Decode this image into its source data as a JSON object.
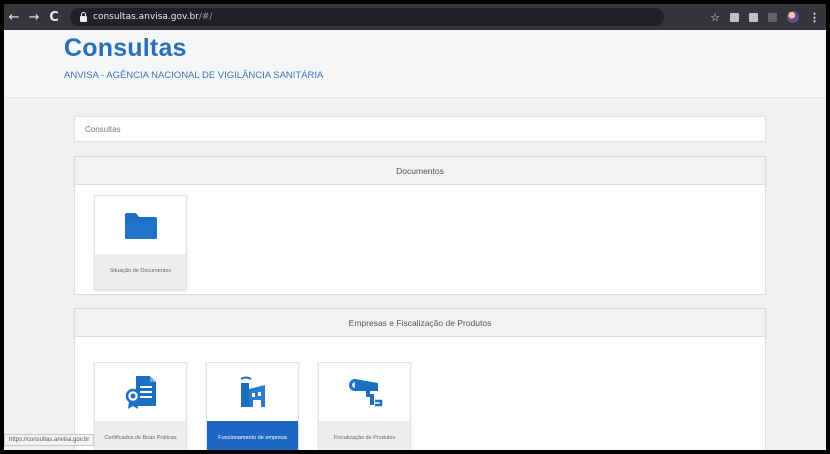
{
  "browser": {
    "url_host": "consultas.anvisa.gov.br",
    "url_path": "/#/",
    "back_icon": "←",
    "forward_icon": "→",
    "reload_icon": "C",
    "star_icon": "☆",
    "menu_icon": "⋮"
  },
  "header": {
    "title": "Consultas",
    "subtitle": "ANVISA - AGÊNCIA NACIONAL DE VIGILÂNCIA SANITÁRIA"
  },
  "breadcrumb": "Consultas",
  "sections": [
    {
      "title": "Documentos",
      "cards": [
        {
          "label": "Situação de Documentos",
          "icon": "folder-icon"
        }
      ]
    },
    {
      "title": "Empresas e Fiscalização de Produtos",
      "cards": [
        {
          "label": "Certificados de Boas Práticas",
          "icon": "certificate-icon"
        },
        {
          "label": "Funcionamento de empresa",
          "icon": "factory-icon"
        },
        {
          "label": "Fiscalização de Produtos",
          "icon": "security-camera-icon"
        }
      ]
    }
  ],
  "status_bar_url": "https://consultas.anvisa.gov.br",
  "colors": {
    "brand_blue": "#2b6fb6",
    "active_card": "#1d67c2"
  }
}
